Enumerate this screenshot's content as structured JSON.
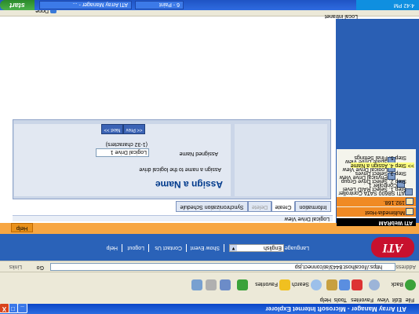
{
  "window": {
    "title": "ATI Array Manager - Microsoft Internet Explorer",
    "controls": {
      "minimize": "_",
      "maximize": "□",
      "close": "X"
    }
  },
  "menubar": [
    "File",
    "Edit",
    "View",
    "Favorites",
    "Tools",
    "Help"
  ],
  "toolbar": {
    "back": "Back",
    "search": "Search",
    "favorites": "Favorites"
  },
  "address": {
    "label": "Address",
    "url": "https://localhost:8443/at/connect.jsp",
    "go": "Go",
    "links": "Links"
  },
  "nav": {
    "language_label": "Language",
    "language_value": "English",
    "items": [
      "Show Event",
      "Contact Us",
      "Logout",
      "Help"
    ]
  },
  "brand": {
    "logo": "ATI"
  },
  "section_bar": {
    "help": "Help"
  },
  "tree": {
    "root": "ATI WebRAM",
    "items": [
      {
        "label": "Multimedia-Host",
        "highlight": true
      },
      {
        "label": "192.168.",
        "highlight": true
      },
      {
        "label": "ATI SB600 SATA Controller",
        "highlight": false
      },
      {
        "label": "Controller 1",
        "highlight": false
      },
      {
        "label": "Physical Drive View",
        "highlight": false
      },
      {
        "label": "Logical Drive View",
        "highlight": false
      },
      {
        "label": "Spare Drive View",
        "highlight": false
      }
    ]
  },
  "page": {
    "header": "Logical Drive View",
    "tabs": [
      {
        "label": "Information",
        "active": false,
        "disabled": false
      },
      {
        "label": "Create",
        "active": true,
        "disabled": false
      },
      {
        "label": "Delete",
        "active": false,
        "disabled": true
      },
      {
        "label": "Synchronization Schedule",
        "active": false,
        "disabled": false
      }
    ],
    "steps": [
      {
        "label": "Step 1. Select RAID Level",
        "current": false
      },
      {
        "label": "Step 2. Select Drive Group",
        "current": false
      },
      {
        "label": "Step 3. Select Drives",
        "current": false
      },
      {
        "label": ">> Step 4. Assign a Name",
        "current": true
      },
      {
        "label": "Step 5. Final Settings",
        "current": false
      }
    ],
    "heading": "Assign a Name",
    "hint": "Assign a name to the logical drive",
    "field_label": "Assigned Name",
    "field_value": "Logical Drive 1",
    "field_range": "(1-32 characters)",
    "prev": "<< Prev",
    "next": "Next >>"
  },
  "status": {
    "text": "Local intranet",
    "done": "Done"
  },
  "taskbar": {
    "start": "start",
    "tasks": [
      "ATI Array Manager - ...",
      "6 - Paint"
    ],
    "time": "4:42 PM"
  },
  "colors": {
    "banner": "#2a62b8",
    "orange": "#f7a642",
    "tree_highlight": "#f08a24",
    "heading": "#003a8c"
  }
}
